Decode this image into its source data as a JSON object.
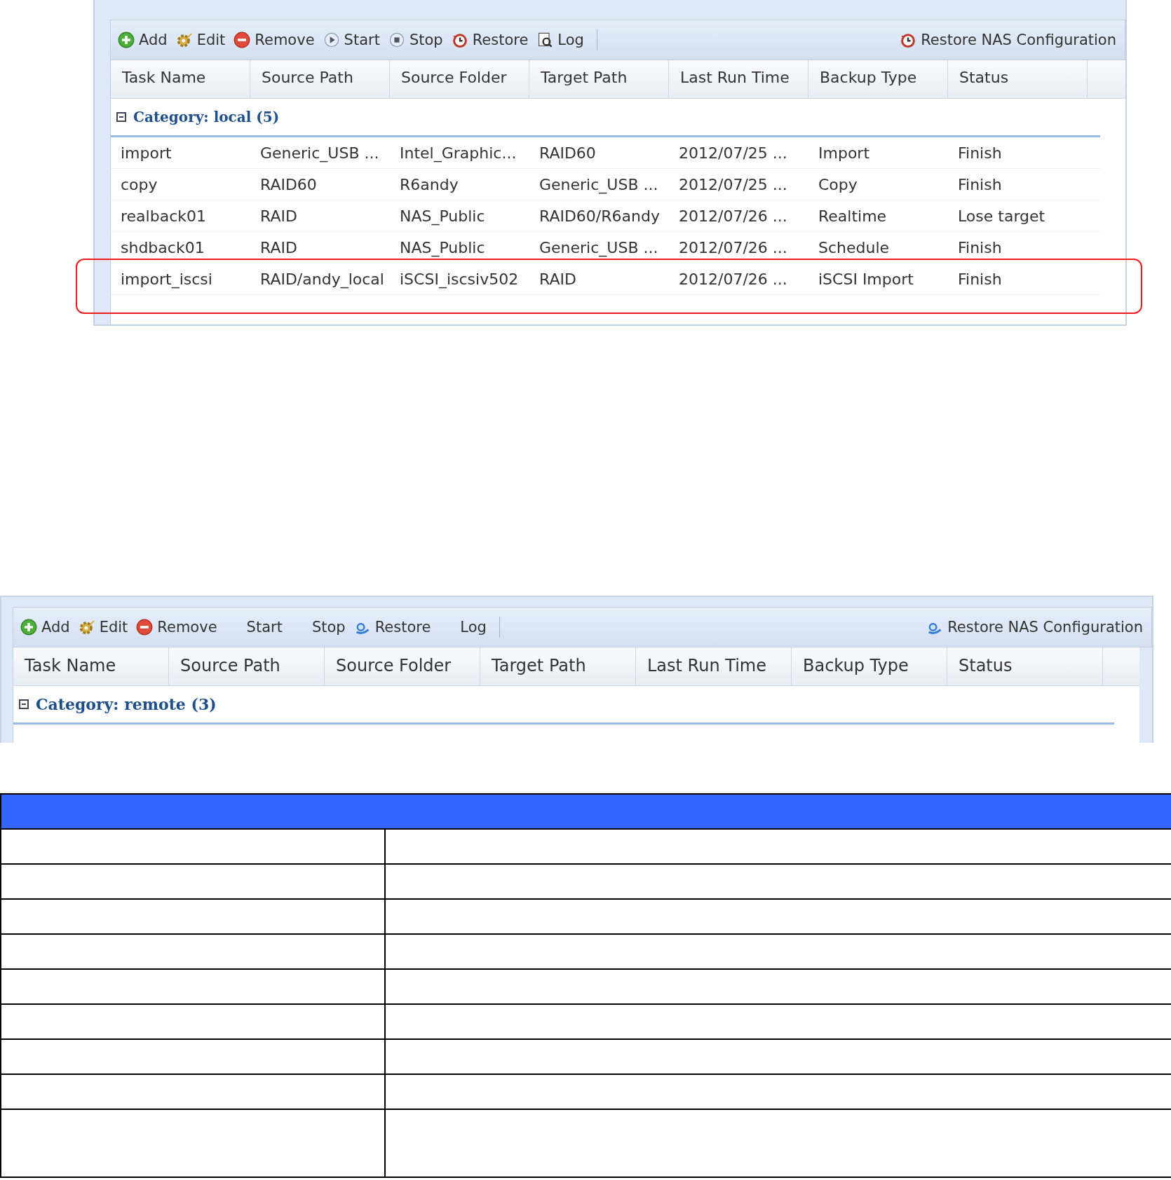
{
  "panels": [
    {
      "toolbar": {
        "buttons": [
          {
            "label": "Add",
            "kind": "add"
          },
          {
            "label": "Edit",
            "kind": "edit"
          },
          {
            "label": "Remove",
            "kind": "remove"
          },
          {
            "label": "Start",
            "kind": "play"
          },
          {
            "label": "Stop",
            "kind": "stop"
          },
          {
            "label": "Restore",
            "kind": "clock"
          },
          {
            "label": "Log",
            "kind": "log"
          }
        ],
        "right_button": {
          "label": "Restore NAS Configuration",
          "kind": "clock"
        }
      },
      "columns": [
        "Task Name",
        "Source Path",
        "Source Folder",
        "Target Path",
        "Last Run Time",
        "Backup Type",
        "Status"
      ],
      "category": {
        "label": "Category: local (5)",
        "expanded": true
      },
      "rows": [
        {
          "cells": [
            "import",
            "Generic_USB ...",
            "Intel_Graphic...",
            "RAID60",
            "2012/07/25 ...",
            "Import",
            "Finish"
          ],
          "highlighted": false
        },
        {
          "cells": [
            "copy",
            "RAID60",
            "R6andy",
            "Generic_USB ...",
            "2012/07/25 ...",
            "Copy",
            "Finish"
          ],
          "highlighted": false
        },
        {
          "cells": [
            "realback01",
            "RAID",
            "NAS_Public",
            "RAID60/R6andy",
            "2012/07/26 ...",
            "Realtime",
            "Lose target"
          ],
          "highlighted": false
        },
        {
          "cells": [
            "shdback01",
            "RAID",
            "NAS_Public",
            "Generic_USB ...",
            "2012/07/26 ...",
            "Schedule",
            "Finish"
          ],
          "highlighted": false
        },
        {
          "cells": [
            "import_iscsi",
            "RAID/andy_local",
            "iSCSI_iscsiv502",
            "RAID",
            "2012/07/26 ...",
            "iSCSI Import",
            "Finish"
          ],
          "highlighted": true
        }
      ]
    },
    {
      "toolbar": {
        "buttons": [
          {
            "label": "Add",
            "kind": "add"
          },
          {
            "label": "Edit",
            "kind": "edit"
          },
          {
            "label": "Remove",
            "kind": "remove"
          },
          {
            "label": "Start",
            "kind": "plain"
          },
          {
            "label": "Stop",
            "kind": "plain"
          },
          {
            "label": "Restore",
            "kind": "magnifier"
          },
          {
            "label": "Log",
            "kind": "plain"
          }
        ],
        "right_button": {
          "label": "Restore NAS Configuration",
          "kind": "magnifier"
        }
      },
      "columns": [
        "Task Name",
        "Source Path",
        "Source Folder",
        "Target Path",
        "Last Run Time",
        "Backup Type",
        "Status"
      ],
      "category": {
        "label": "Category: remote (3)",
        "expanded": true
      }
    }
  ],
  "doc_table": {
    "rows": [
      {
        "kind": "normal"
      },
      {
        "kind": "normal"
      },
      {
        "kind": "normal"
      },
      {
        "kind": "normal"
      },
      {
        "kind": "normal"
      },
      {
        "kind": "normal"
      },
      {
        "kind": "normal"
      },
      {
        "kind": "normal"
      },
      {
        "kind": "tall"
      }
    ]
  }
}
